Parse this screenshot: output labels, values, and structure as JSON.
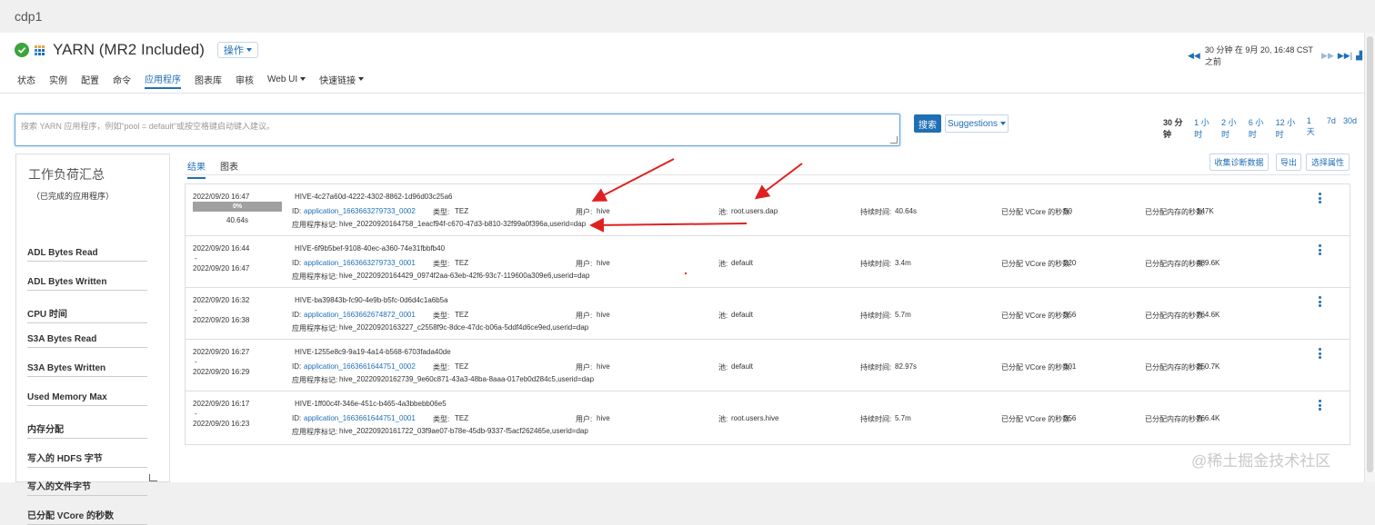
{
  "cluster": {
    "name": "cdp1"
  },
  "service": {
    "title": "YARN (MR2 Included)",
    "actions_label": "操作"
  },
  "time_nav": {
    "text": "30 分钟 在 9月 20, 16:48 CST 之前"
  },
  "tabs": [
    "状态",
    "实例",
    "配置",
    "命令",
    "应用程序",
    "图表库",
    "审核",
    "Web UI",
    "快速链接"
  ],
  "active_tab": "应用程序",
  "search": {
    "placeholder": "搜索 YARN 应用程序，例如\"pool = default\"或按空格键启动键入建议。",
    "button": "搜索",
    "suggestions": "Suggestions"
  },
  "time_ranges": [
    "30 分钟",
    "1 小时",
    "2 小时",
    "6 小时",
    "12 小时",
    "1 天",
    "7d",
    "30d"
  ],
  "sidebar": {
    "title": "工作负荷汇总",
    "subtitle": "（已完成的应用程序）",
    "items": [
      "ADL Bytes Read",
      "ADL Bytes Written",
      "CPU 时间",
      "S3A Bytes Read",
      "S3A Bytes Written",
      "Used Memory Max",
      "内存分配",
      "写入的 HDFS 字节",
      "写入的文件字节",
      "已分配 VCore 的秒数"
    ]
  },
  "result_tabs": [
    "结果",
    "图表"
  ],
  "actions": [
    "收集诊断数据",
    "导出",
    "选择属性"
  ],
  "labels": {
    "id": "ID:",
    "type": "类型:",
    "user": "用户:",
    "pool": "池:",
    "duration": "持续时间:",
    "vcore": "已分配 VCore 的秒数:",
    "memory": "已分配内存的秒数:",
    "tag": "应用程序标记:"
  },
  "apps": [
    {
      "start": "2022/09/20 16:47",
      "end": "",
      "progress": "0%",
      "progress_value": 0,
      "elapsed": "40.64s",
      "name": "HIVE-4c27a60d-4222-4302-8862-1d96d03c25a6",
      "app_id": "application_1663663279733_0002",
      "type": "TEZ",
      "user": "hive",
      "pool": "root.users.dap",
      "duration": "40.64s",
      "vcore": "50",
      "memory": "147K",
      "tag": "hive_20220920164758_1eacf94f-c670-47d3-b810-32f99a0f396a,userid=dap"
    },
    {
      "start": "2022/09/20 16:44",
      "end": "2022/09/20 16:47",
      "progress": "",
      "elapsed": "",
      "name": "HIVE-6f9b5bef-9108-40ec-a360-74e31fbbfb40",
      "app_id": "application_1663663279733_0001",
      "type": "TEZ",
      "user": "hive",
      "pool": "default",
      "duration": "3.4m",
      "vcore": "220",
      "memory": "489.6K",
      "tag": "hive_20220920164429_0974f2aa-63eb-42f6-93c7-119600a309e6,userid=dap"
    },
    {
      "start": "2022/09/20 16:32",
      "end": "2022/09/20 16:38",
      "progress": "",
      "elapsed": "",
      "name": "HIVE-ba39843b-fc90-4e9b-b5fc-0d6d4c1a6b5a",
      "app_id": "application_1663662674872_0001",
      "type": "TEZ",
      "user": "hive",
      "pool": "default",
      "duration": "5.7m",
      "vcore": "356",
      "memory": "764.6K",
      "tag": "hive_20220920163227_c2558f9c-8dce-47dc-b06a-5ddf4d6ce9ed,userid=dap"
    },
    {
      "start": "2022/09/20 16:27",
      "end": "2022/09/20 16:29",
      "progress": "",
      "elapsed": "",
      "name": "HIVE-1255e8c9-9a19-4a14-b568-6703fada40de",
      "app_id": "application_1663661644751_0002",
      "type": "TEZ",
      "user": "hive",
      "pool": "default",
      "duration": "82.97s",
      "vcore": "101",
      "memory": "250.7K",
      "tag": "hive_20220920162739_9e60c871-43a3-48ba-8aaa-017eb0d284c5,userid=dap"
    },
    {
      "start": "2022/09/20 16:17",
      "end": "2022/09/20 16:23",
      "progress": "",
      "elapsed": "",
      "name": "HIVE-1ff00c4f-346e-451c-b465-4a3bbebb06e5",
      "app_id": "application_1663661644751_0001",
      "type": "TEZ",
      "user": "hive",
      "pool": "root.users.hive",
      "duration": "5.7m",
      "vcore": "356",
      "memory": "766.4K",
      "tag": "hive_20220920161722_03f9ae07-b78e-45db-9337-f5acf262465e,userid=dap"
    }
  ],
  "watermark": "@稀土掘金技术社区",
  "colors": {
    "accent": "#1f6fb5",
    "ok": "#3aa63a",
    "arrow": "#e02020"
  }
}
